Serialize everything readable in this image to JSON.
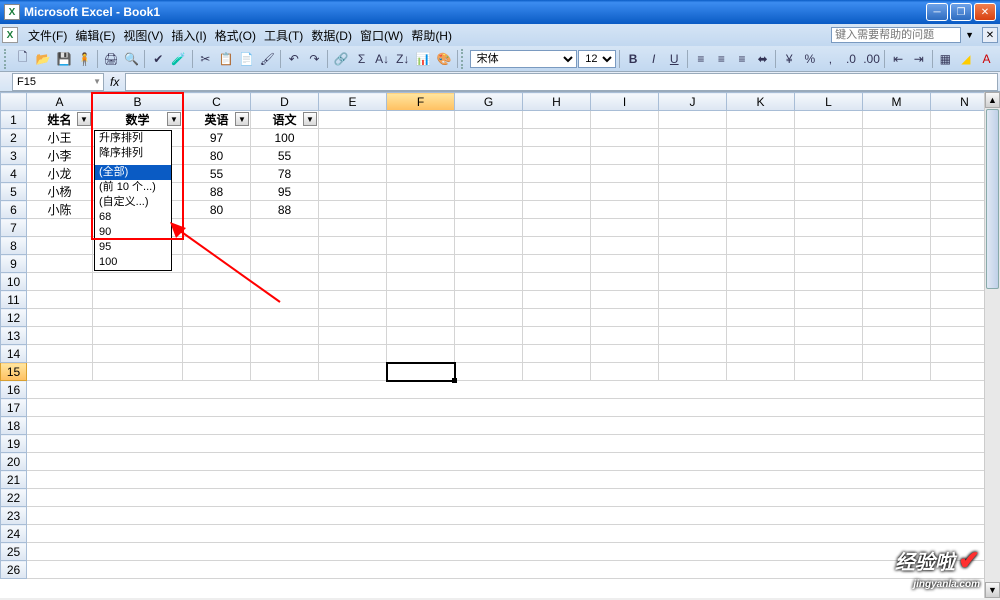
{
  "window": {
    "title": "Microsoft Excel - Book1"
  },
  "menubar": {
    "file": "文件(F)",
    "edit": "编辑(E)",
    "view": "视图(V)",
    "insert": "插入(I)",
    "format": "格式(O)",
    "tools": "工具(T)",
    "data": "数据(D)",
    "window": "窗口(W)",
    "help": "帮助(H)",
    "help_placeholder": "键入需要帮助的问题"
  },
  "toolbar": {
    "font_name": "宋体",
    "font_size": "12"
  },
  "namebox": {
    "cell_ref": "F15",
    "formula": ""
  },
  "columns": [
    "A",
    "B",
    "C",
    "D",
    "E",
    "F",
    "G",
    "H",
    "I",
    "J",
    "K",
    "L",
    "M",
    "N"
  ],
  "headers": {
    "A": "姓名",
    "B": "数学",
    "C": "英语",
    "D": "语文"
  },
  "rows": [
    {
      "A": "小王",
      "C": "97",
      "D": "100"
    },
    {
      "A": "小李",
      "C": "80",
      "D": "55"
    },
    {
      "A": "小龙",
      "C": "55",
      "D": "78"
    },
    {
      "A": "小杨",
      "C": "88",
      "D": "95"
    },
    {
      "A": "小陈",
      "C": "80",
      "D": "88"
    }
  ],
  "dropdown": {
    "sort_asc": "升序排列",
    "sort_desc": "降序排列",
    "all": "(全部)",
    "top10": "(前 10 个...)",
    "custom": "(自定义...)",
    "v1": "68",
    "v2": "90",
    "v3": "95",
    "v4": "100"
  },
  "watermark": {
    "text": "经验啦",
    "url": "jingyanla.com"
  }
}
